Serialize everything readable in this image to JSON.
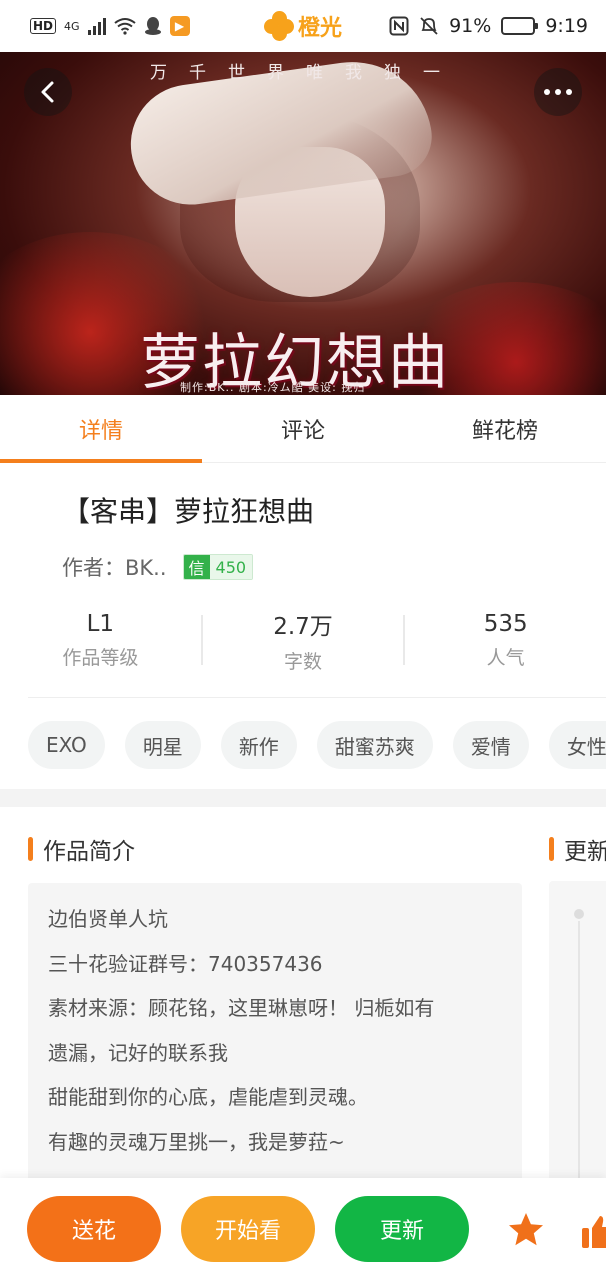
{
  "status_bar": {
    "hd": "HD",
    "network": "4G",
    "brand": "橙光",
    "battery_pct": "91%",
    "time": "9:19"
  },
  "banner": {
    "top_text": "万千世界唯我独一",
    "title_art": "萝拉幻想曲",
    "credits": "制作:BK.. 剧本:冷ム酷 美设: 挽归"
  },
  "tabs": [
    {
      "label": "详情",
      "active": true
    },
    {
      "label": "评论",
      "active": false
    },
    {
      "label": "鲜花榜",
      "active": false
    }
  ],
  "work": {
    "title": "【客串】萝拉狂想曲",
    "author_label": "作者：BK..",
    "credit_icon": "信",
    "credit_value": "450"
  },
  "stats": [
    {
      "value": "L1",
      "label": "作品等级"
    },
    {
      "value": "2.7万",
      "label": "字数"
    },
    {
      "value": "535",
      "label": "人气"
    }
  ],
  "tags": [
    "EXO",
    "明星",
    "新作",
    "甜蜜苏爽",
    "爱情",
    "女性向"
  ],
  "synopsis": {
    "heading": "作品简介",
    "lines": [
      "边伯贤单人坑",
      "三十花验证群号：740357436",
      "素材来源：顾花铭，这里琳崽呀！ 归栀如有",
      "遗漏，记好的联系我",
      "甜能甜到你的心底，虐能虐到灵魂。",
      "有趣的灵魂万里挑一，我是萝菈~"
    ]
  },
  "update_section": {
    "heading": "更新"
  },
  "bottom_bar": {
    "flower_label": "送花",
    "read_label": "开始看",
    "update_label": "更新"
  },
  "colors": {
    "accent": "#f47f1d",
    "flower_btn": "#f37118",
    "read_btn": "#f7a426",
    "update_btn": "#12b645",
    "credit_green": "#33b14a"
  }
}
